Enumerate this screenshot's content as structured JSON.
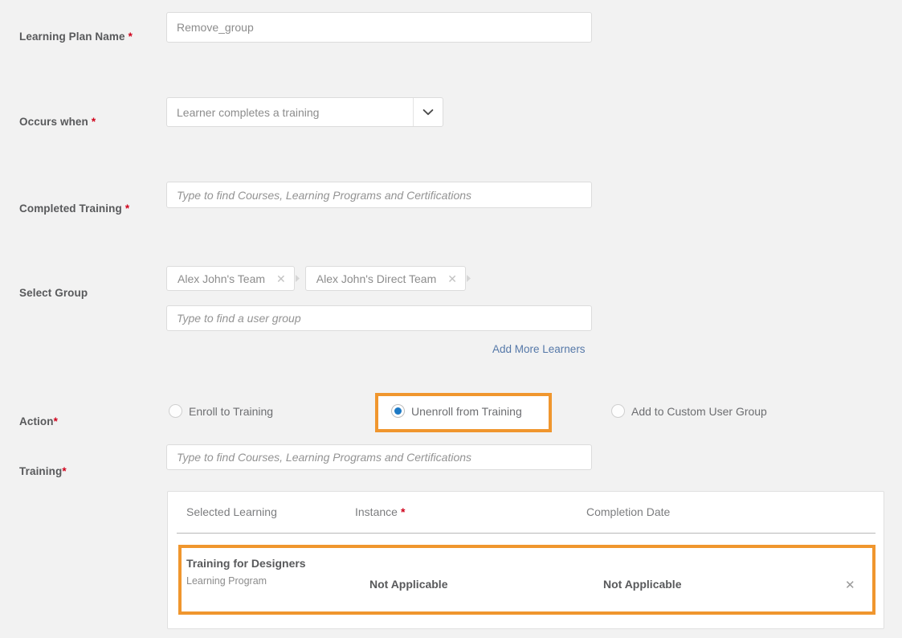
{
  "form": {
    "fields": [
      {
        "label": "Learning Plan Name",
        "required": true,
        "required_spaced": true,
        "value": "Remove_group",
        "placeholder": "",
        "type": "text"
      },
      {
        "label": "Occurs when",
        "required": true,
        "required_spaced": true,
        "value": "Learner completes a training",
        "type": "select"
      },
      {
        "label": "Completed Training",
        "required": true,
        "required_spaced": true,
        "value": "",
        "placeholder": "Type to find Courses, Learning Programs and Certifications",
        "type": "text"
      },
      {
        "label": "Select Group",
        "required": false,
        "required_spaced": false,
        "value": "",
        "placeholder": "Type to find a user group",
        "type": "text"
      },
      {
        "label": "Action",
        "required": true,
        "required_spaced": false,
        "type": "radio-group"
      },
      {
        "label": "Training",
        "required": true,
        "required_spaced": false,
        "value": "",
        "placeholder": "Type to find Courses, Learning Programs and Certifications",
        "type": "text"
      }
    ],
    "group_chips": [
      {
        "label": "Alex John's Team",
        "remove_icon": "close-icon"
      },
      {
        "label": "Alex John's Direct Team",
        "remove_icon": "close-icon"
      }
    ],
    "add_more_learners_link": "Add More Learners",
    "action_options": [
      {
        "label": "Enroll to Training",
        "selected": false,
        "highlighted": false
      },
      {
        "label": "Unenroll from Training",
        "selected": true,
        "highlighted": true
      },
      {
        "label": "Add to Custom User Group",
        "selected": false,
        "highlighted": false
      }
    ],
    "select_arrow_icon": "chevron-down-icon"
  },
  "table": {
    "columns": [
      {
        "label": "Selected Learning",
        "required": false
      },
      {
        "label": "Instance",
        "required": true
      },
      {
        "label": "Completion Date",
        "required": false
      }
    ],
    "rows": [
      {
        "title": "Training for Designers",
        "subtitle": "Learning Program",
        "instance": "Not Applicable",
        "completion_date": "Not Applicable",
        "remove_icon": "close-icon",
        "highlighted": true
      }
    ]
  },
  "colors": {
    "highlight": "#f0962e",
    "radio_selected": "#1d79c4",
    "required_asterisk": "#d0021b",
    "link": "#5578a8",
    "page_background": "#f2f2f2",
    "panel_background": "#ffffff"
  }
}
